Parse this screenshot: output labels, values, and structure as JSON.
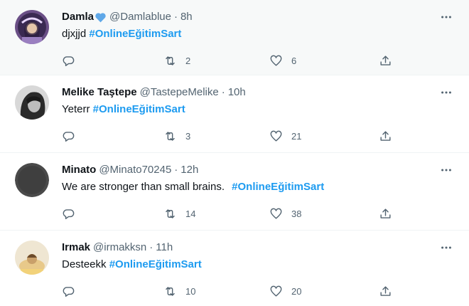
{
  "tweets": [
    {
      "name": "Damla",
      "handle": "@Damlablue",
      "time": "8h",
      "text": "djxjjd",
      "hashtag": "#OnlineEğitimSart",
      "retweets": "2",
      "likes": "6",
      "badge_icon": "blue-heart-icon",
      "highlight": true
    },
    {
      "name": "Melike Taştepe",
      "handle": "@TastepeMelike",
      "time": "10h",
      "text": "Yeterr",
      "hashtag": "#OnlineEğitimSart",
      "retweets": "3",
      "likes": "21"
    },
    {
      "name": "Minato",
      "handle": "@Minato70245",
      "time": "12h",
      "text": "We are stronger than small brains.",
      "hashtag": "#OnlineEğitimSart",
      "retweets": "14",
      "likes": "38"
    },
    {
      "name": "Irmak",
      "handle": "@irmakksn",
      "time": "11h",
      "text": "Desteekk",
      "hashtag": "#OnlineEğitimSart",
      "retweets": "10",
      "likes": "20"
    }
  ],
  "separator": "·",
  "colors": {
    "accent": "#1d9bf0",
    "text_primary": "#0f1419",
    "text_secondary": "#536471",
    "highlight_bg": "#f7f9f9"
  },
  "icons": [
    "reply-icon",
    "retweet-icon",
    "like-icon",
    "share-icon",
    "more-icon"
  ]
}
